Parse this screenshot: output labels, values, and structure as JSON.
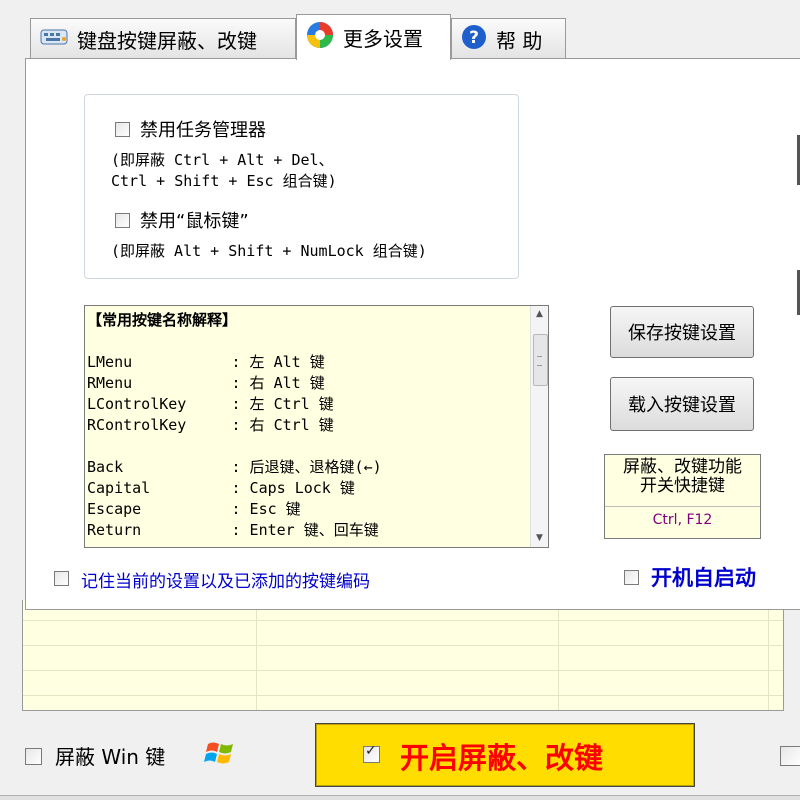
{
  "tabs": [
    {
      "label": "键盘按键屏蔽、改键",
      "icon": "keyboard-icon"
    },
    {
      "label": "更多设置",
      "icon": "colorful-orb-icon",
      "active": true
    },
    {
      "label": "帮 助",
      "icon": "help-icon"
    }
  ],
  "settings": {
    "disable_task_manager": {
      "label": "禁用任务管理器",
      "checked": false,
      "note_line1": "(即屏蔽 Ctrl + Alt + Del、",
      "note_line2": "Ctrl + Shift + Esc 组合键)"
    },
    "disable_mouse_keys": {
      "label": "禁用“鼠标键”",
      "checked": false,
      "note": "(即屏蔽 Alt + Shift + NumLock 组合键)"
    }
  },
  "key_reference": {
    "lines": [
      "【常用按键名称解释】",
      "",
      "LMenu           : 左 Alt 键",
      "RMenu           : 右 Alt 键",
      "LControlKey     : 左 Ctrl 键",
      "RControlKey     : 右 Ctrl 键",
      "",
      "Back            : 后退键、退格键(←)",
      "Capital         : Caps Lock 键",
      "Escape          : Esc 键",
      "Return          : Enter 键、回车键"
    ]
  },
  "buttons": {
    "save": "保存按键设置",
    "load": "载入按键设置"
  },
  "hotkey": {
    "title_line1": "屏蔽、改键功能",
    "title_line2": "开关快捷键",
    "value": "Ctrl, F12"
  },
  "remember": {
    "label": "记住当前的设置以及已添加的按键编码",
    "checked": false
  },
  "autostart": {
    "label": "开机自启动",
    "checked": false
  },
  "block_win": {
    "label": "屏蔽 Win 键",
    "checked": false
  },
  "enable_block": {
    "label": "开启屏蔽、改键",
    "checked": true
  },
  "colors": {
    "accent_blue": "#0000cc",
    "highlight_red": "#ff0000",
    "enable_bg": "#ffdd00",
    "info_bg": "#ffffe1"
  }
}
